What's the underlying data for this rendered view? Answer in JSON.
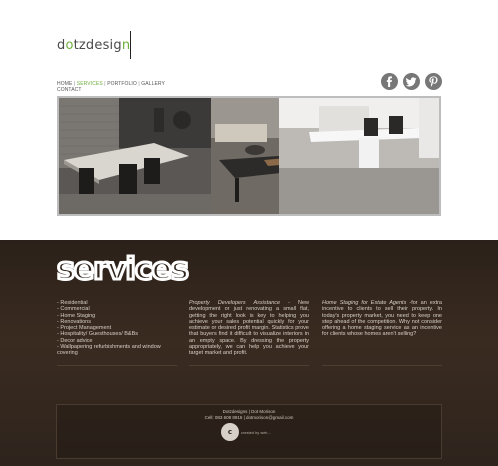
{
  "logo": {
    "part1": "d",
    "o": "o",
    "part2": "tzdesig",
    "n": "n"
  },
  "nav": {
    "items": [
      {
        "label": "HOME",
        "active": false
      },
      {
        "label": "SERVICES",
        "active": true
      },
      {
        "label": "PORTFOLIO",
        "active": false
      },
      {
        "label": "GALLERY",
        "active": false
      },
      {
        "label": "CONTACT",
        "active": false
      }
    ],
    "separator": " | "
  },
  "social": {
    "facebook": "facebook-icon",
    "twitter": "twitter-icon",
    "pinterest": "pinterest-icon"
  },
  "services": {
    "title": "services",
    "list": [
      "Residential",
      "Commercial",
      "Home Staging",
      "Renovations",
      "Project Management",
      "Hospitality/ Guesthouses/ B&Bs",
      "Decor advice",
      "Wallpapering refurbishments and window covering"
    ],
    "col2_italic": "Property Developers Assistance",
    "col2_text": " - New development or just renovating a small flat, getting the right look is key to helping you achieve your sales potential quickly for your estimate or desired profit margin. Statistics prove that buyers find it difficult to visualize interiors in an empty space. By dressing the property appropriately, we can help you achieve your target market and profit.",
    "col3_italic": "Home Staging for Estate Agents",
    "col3_text": " -for an extra incentive to clients to sell their property. In today's property market, you need to keep one step ahead of the competition. Why not consider offering a home staging service as an incentive for clients whose homes aren't selling?"
  },
  "footer": {
    "line1": "Dotzdesigns | Dot Morison",
    "line2": "Cell: 083 608 8916 | dotmorison@gmail.com",
    "logo_text": "c",
    "credit": "created by web..."
  },
  "colors": {
    "accent": "#6cae3c",
    "dark_bg": "#2e241d",
    "icon_gray": "#777777"
  }
}
